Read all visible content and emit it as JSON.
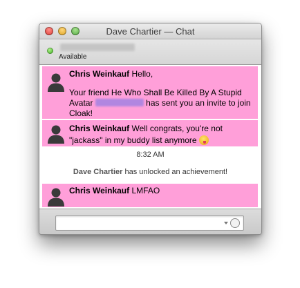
{
  "window": {
    "title": "Dave Chartier — Chat"
  },
  "status": {
    "label": "Available"
  },
  "messages": [
    {
      "sender": "Chris Weinkauf",
      "text_line1": "Hello,",
      "text_part_a": "Your friend He Who Shall Be Killed By A Stupid Avatar",
      "text_part_b": "has sent you an invite to join Cloak!"
    },
    {
      "sender": "Chris Weinkauf",
      "text": "Well congrats, you're not \"jackass\" in my buddy list anymore"
    },
    {
      "sender": "Chris Weinkauf",
      "text": "LMFAO"
    }
  ],
  "timestamp": "8:32 AM",
  "system_message": {
    "who": "Dave Chartier",
    "text": "has unlocked an achievement!"
  },
  "icons": {
    "status": "available-dot-icon",
    "avatar": "default-user-avatar-icon",
    "emoji": "tongue-out-emoji-icon",
    "emoticon_picker": "smiley-icon"
  },
  "colors": {
    "message_background": "#ff9fd9",
    "available_green": "#34a515"
  }
}
